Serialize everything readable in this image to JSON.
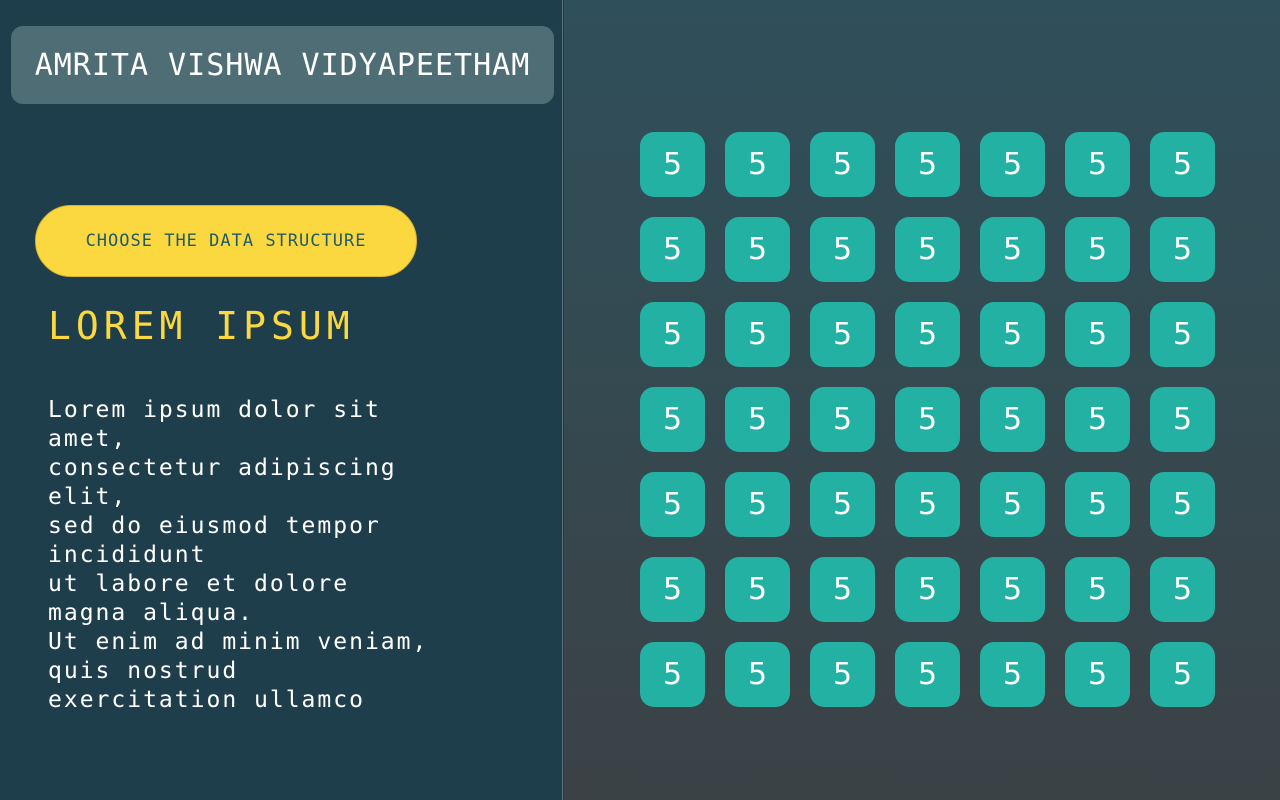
{
  "header": {
    "title": "AMRITA VISHWA VIDYAPEETHAM"
  },
  "controls": {
    "choose_label": "CHOOSE THE DATA STRUCTURE"
  },
  "content": {
    "heading": "LOREM IPSUM",
    "lines": [
      "Lorem ipsum dolor sit",
      "amet,",
      "consectetur adipiscing",
      "elit,",
      "sed do eiusmod tempor",
      "incididunt",
      "ut labore et dolore",
      "magna aliqua.",
      "Ut enim ad minim veniam,",
      "quis nostrud",
      "exercitation ullamco"
    ]
  },
  "grid": {
    "rows": [
      [
        "5",
        "5",
        "5",
        "5",
        "5",
        "5",
        "5"
      ],
      [
        "5",
        "5",
        "5",
        "5",
        "5",
        "5",
        "5"
      ],
      [
        "5",
        "5",
        "5",
        "5",
        "5",
        "5",
        "5"
      ],
      [
        "5",
        "5",
        "5",
        "5",
        "5",
        "5",
        "5"
      ],
      [
        "5",
        "5",
        "5",
        "5",
        "5",
        "5",
        "5"
      ],
      [
        "5",
        "5",
        "5",
        "5",
        "5",
        "5",
        "5"
      ],
      [
        "5",
        "5",
        "5",
        "5",
        "5",
        "5",
        "5"
      ]
    ]
  },
  "colors": {
    "left_background": "#1f3e4c",
    "accent_yellow": "#fbd840",
    "cell_teal": "#22b1a3",
    "title_box": "#4f6d74"
  }
}
